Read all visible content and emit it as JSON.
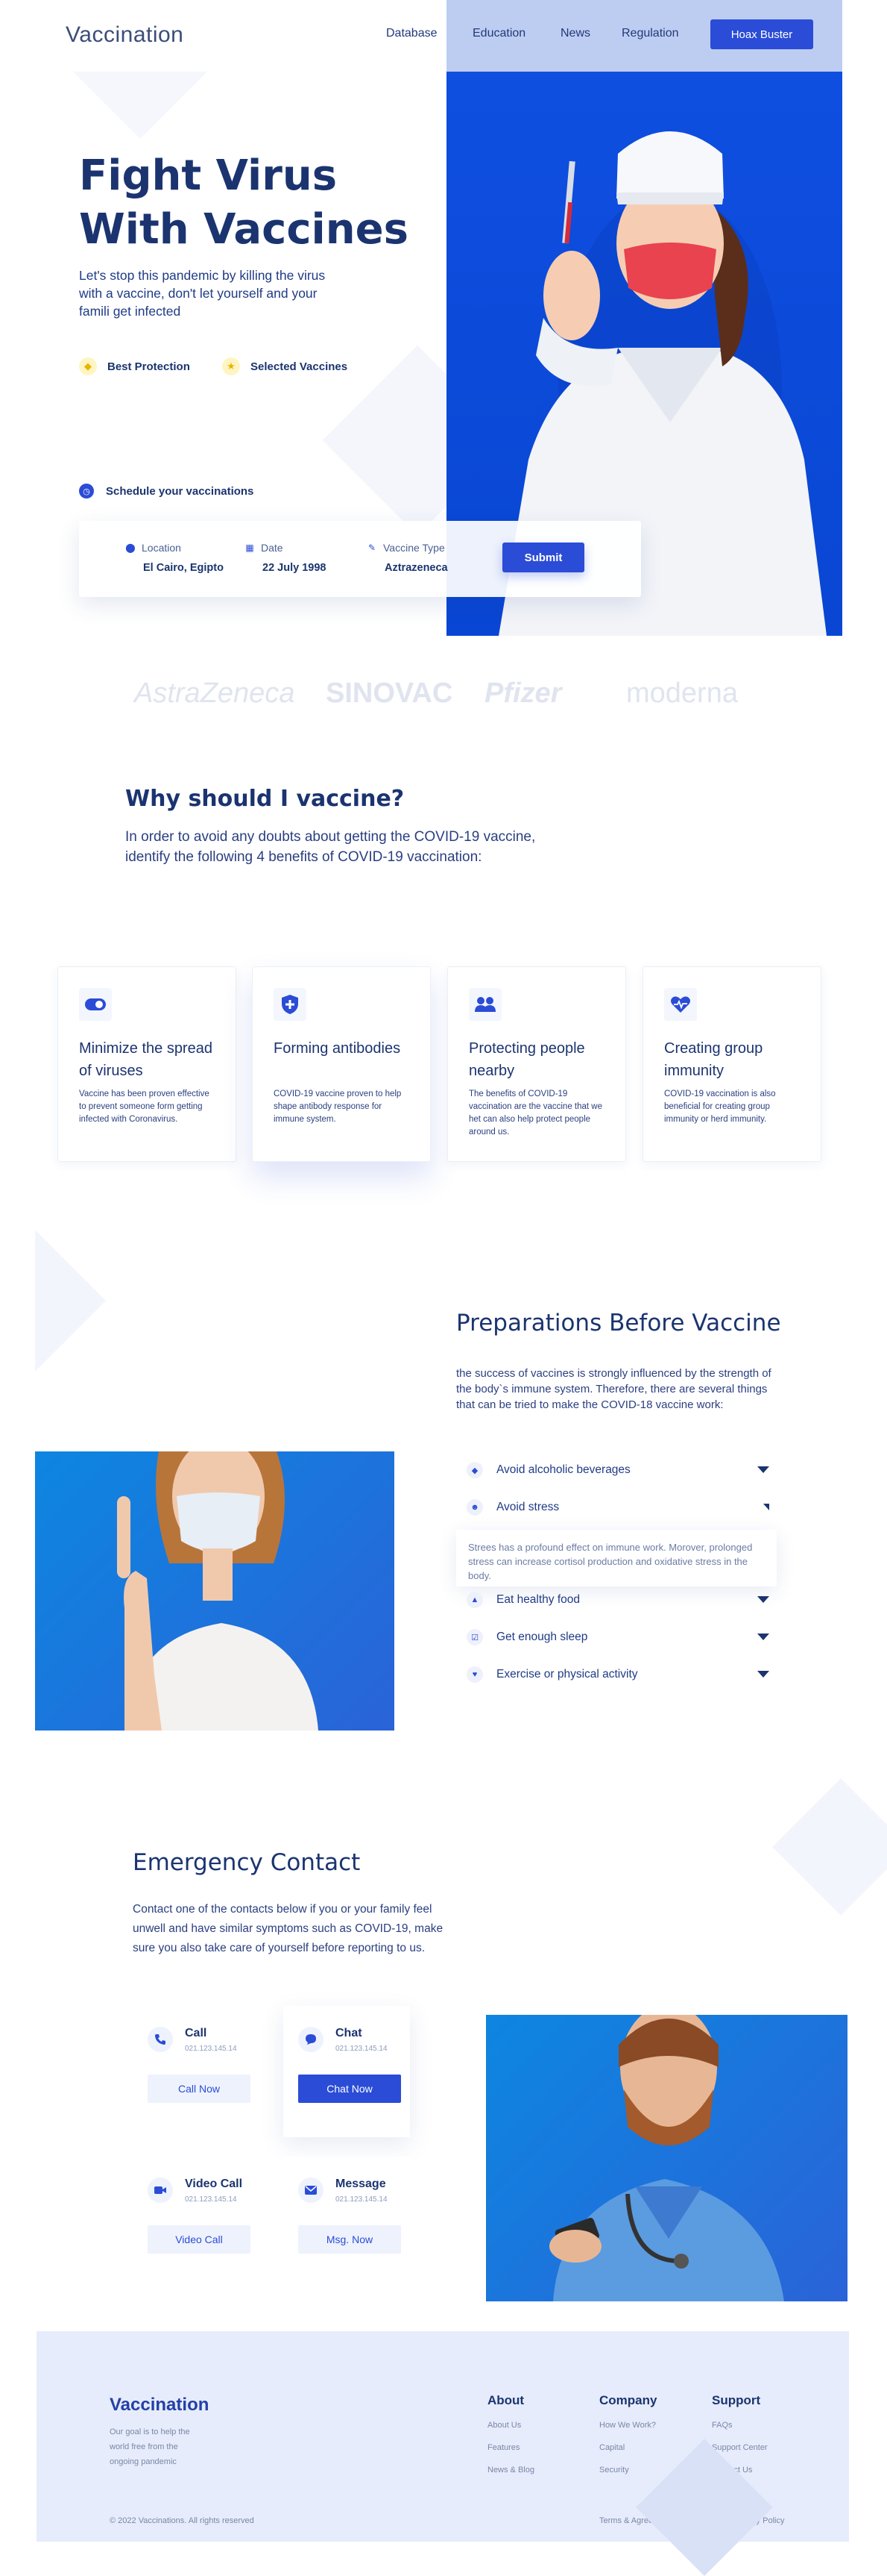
{
  "header": {
    "logo": "Vaccination",
    "nav": [
      "Database",
      "Education",
      "News",
      "Regulation"
    ],
    "cta": "Hoax Buster"
  },
  "hero": {
    "title_line1": "Fight Virus",
    "title_line2": "With Vaccines",
    "subtitle": "Let's stop this pandemic by killing the virus with a vaccine, don't let yourself and your famili get infected",
    "features": [
      "Best Protection",
      "Selected Vaccines"
    ],
    "schedule_label": "Schedule your vaccinations",
    "form": {
      "location_label": "Location",
      "location_value": "El Cairo, Egipto",
      "date_label": "Date",
      "date_value": "22 July 1998",
      "vaccine_label": "Vaccine Type",
      "vaccine_value": "Aztrazeneca",
      "submit": "Submit"
    }
  },
  "brands": [
    "AstraZeneca",
    "SINOVAC",
    "Pfizer",
    "moderna"
  ],
  "why": {
    "title": "Why should I vaccine?",
    "description": "In order to avoid any doubts about getting the COVID-19 vaccine, identify the following 4 benefits of COVID-19 vaccination:",
    "cards": [
      {
        "title": "Minimize the spread of viruses",
        "text": "Vaccine has been proven effective to prevent someone form getting infected with Coronavirus."
      },
      {
        "title": "Forming antibodies",
        "text": "COVID-19 vaccine proven to help shape antibody response for immune system."
      },
      {
        "title": "Protecting people nearby",
        "text": "The benefits of COVID-19 vaccination are the vaccine that we het can also help protect people around us."
      },
      {
        "title": "Creating group immunity",
        "text": "COVID-19 vaccination is also beneficial for creating group immunity or herd immunity."
      }
    ]
  },
  "prep": {
    "title": "Preparations Before Vaccine",
    "description": "the success of vaccines is strongly influenced by the strength of the body`s immune system. Therefore, there are several things that can be tried to make the COVID-18 vaccine work:",
    "items": [
      {
        "label": "Avoid alcoholic beverages",
        "icon": "shield-icon"
      },
      {
        "label": "Avoid stress",
        "icon": "smile-icon"
      },
      {
        "label": "Eat healthy food",
        "icon": "chart-icon"
      },
      {
        "label": "Get enough sleep",
        "icon": "check-square-icon"
      },
      {
        "label": "Exercise or physical activity",
        "icon": "heart-icon"
      }
    ],
    "expanded_text": "Strees has a profound effect on immune work. Morover, prolonged stress can increase cortisol production and oxidative stress in the body."
  },
  "emergency": {
    "title": "Emergency Contact",
    "description": "Contact one of the contacts below if you or your family feel unwell and have similar symptoms such as COVID-19, make sure you also take care of yourself before reporting to us.",
    "contacts": [
      {
        "name": "Call",
        "number": "021.123.145.14",
        "button": "Call Now"
      },
      {
        "name": "Chat",
        "number": "021.123.145.14",
        "button": "Chat Now"
      },
      {
        "name": "Video Call",
        "number": "021.123.145.14",
        "button": "Video Call"
      },
      {
        "name": "Message",
        "number": "021.123.145.14",
        "button": "Msg. Now"
      }
    ]
  },
  "footer": {
    "logo": "Vaccination",
    "tagline": "Our goal is to help the world free from the ongoing pandemic",
    "columns": [
      {
        "title": "About",
        "links": [
          "About Us",
          "Features",
          "News & Blog"
        ]
      },
      {
        "title": "Company",
        "links": [
          "How We Work?",
          "Capital",
          "Security"
        ]
      },
      {
        "title": "Support",
        "links": [
          "FAQs",
          "Support Center",
          "Contact Us"
        ]
      }
    ],
    "copyright": "© 2022 Vaccinations. All rights reserved",
    "terms": "Terms & Agreements",
    "privacy": "Privacy Policy"
  },
  "colors": {
    "primary": "#2b4cd6",
    "navy": "#1b3470",
    "footer_bg": "#e6ecfb",
    "hero_blue": "#0f4fe0"
  }
}
